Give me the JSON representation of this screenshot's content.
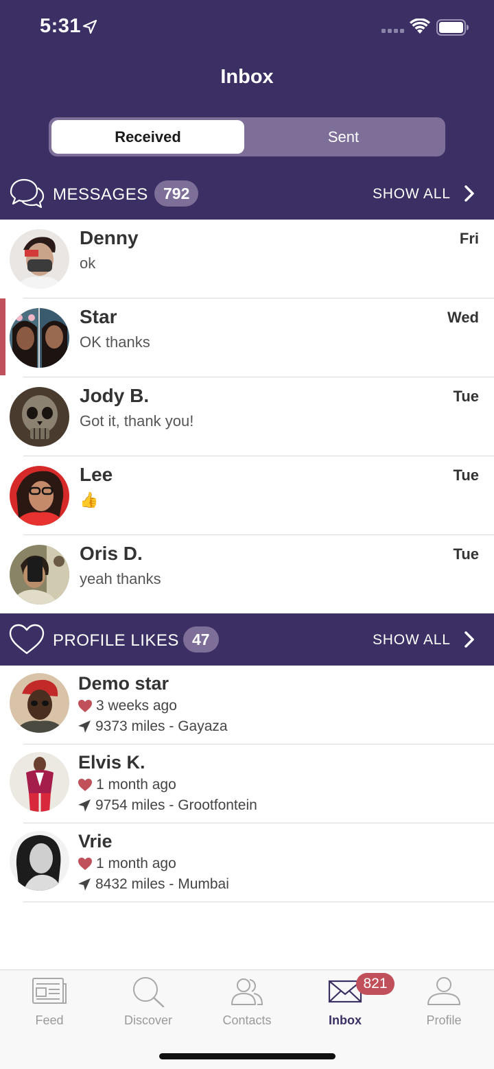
{
  "status": {
    "time": "5:31"
  },
  "header": {
    "title": "Inbox"
  },
  "segment": {
    "received": "Received",
    "sent": "Sent"
  },
  "messages_section": {
    "title": "MESSAGES",
    "count": "792",
    "show_all": "SHOW ALL"
  },
  "messages": [
    {
      "name": "Denny",
      "text": "ok",
      "day": "Fri",
      "unread": false
    },
    {
      "name": "Star",
      "text": "OK thanks",
      "day": "Wed",
      "unread": true
    },
    {
      "name": "Jody B.",
      "text": "Got it, thank you!",
      "day": "Tue",
      "unread": false
    },
    {
      "name": "Lee",
      "text": "👍",
      "day": "Tue",
      "unread": false
    },
    {
      "name": "Oris D.",
      "text": "yeah thanks",
      "day": "Tue",
      "unread": false
    }
  ],
  "likes_section": {
    "title": "PROFILE LIKES",
    "count": "47",
    "show_all": "SHOW ALL"
  },
  "likes": [
    {
      "name": "Demo star",
      "when": "3 weeks ago",
      "distance": "9373 miles - Gayaza"
    },
    {
      "name": "Elvis K.",
      "when": "1 month ago",
      "distance": "9754 miles - Grootfontein"
    },
    {
      "name": "Vrie",
      "when": "1 month ago",
      "distance": "8432 miles - Mumbai"
    }
  ],
  "tabs": [
    {
      "label": "Feed",
      "icon": "feed-icon"
    },
    {
      "label": "Discover",
      "icon": "search-icon"
    },
    {
      "label": "Contacts",
      "icon": "contacts-icon"
    },
    {
      "label": "Inbox",
      "icon": "envelope-icon",
      "active": true
    },
    {
      "label": "Profile",
      "icon": "profile-icon"
    }
  ],
  "inbox_badge": "821",
  "colors": {
    "brand": "#3b2f63",
    "segment": "#7e6f99",
    "accent_red": "#c0505a"
  }
}
